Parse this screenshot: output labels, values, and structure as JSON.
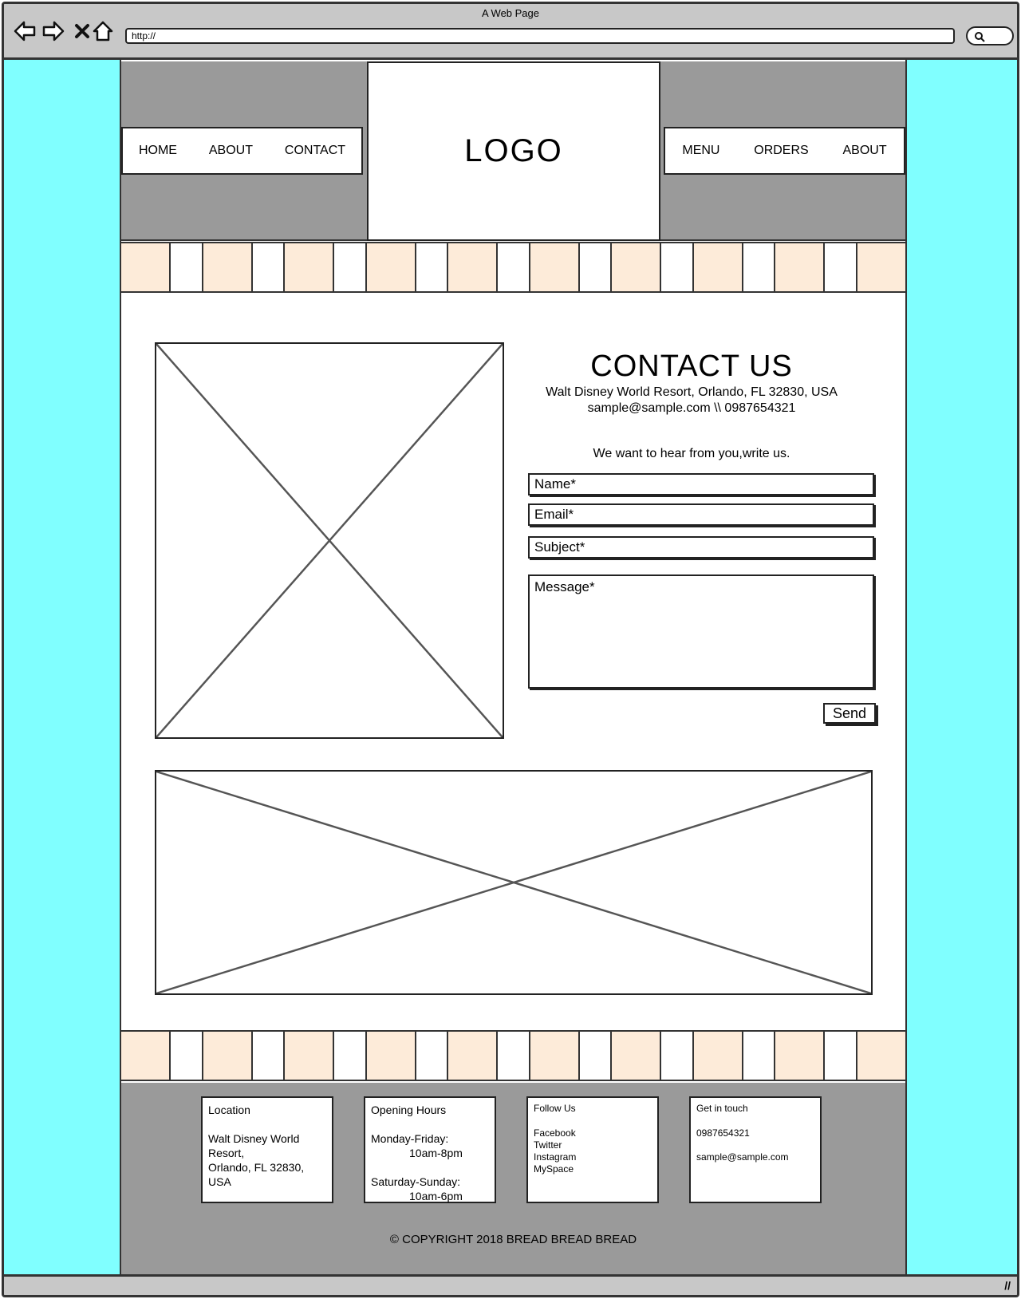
{
  "browser": {
    "title": "A Web Page",
    "url": "http://"
  },
  "header": {
    "logo": "LOGO",
    "nav_left": [
      "HOME",
      "ABOUT",
      "CONTACT"
    ],
    "nav_right": [
      "MENU",
      "ORDERS",
      "ABOUT"
    ]
  },
  "contact": {
    "title": "CONTACT US",
    "address": "Walt Disney World Resort, Orlando, FL 32830, USA",
    "email_phone": "sample@sample.com \\\\ 0987654321",
    "intro": "We want to hear from you,write us.",
    "fields": {
      "name_placeholder": "Name*",
      "email_placeholder": "Email*",
      "subject_placeholder": "Subject*",
      "message_placeholder": "Message*"
    },
    "send_label": "Send"
  },
  "footer": {
    "location": {
      "heading": "Location",
      "line1": "Walt Disney World",
      "line2": "Resort,",
      "line3": "Orlando, FL 32830,",
      "line4": "USA"
    },
    "hours": {
      "heading": "Opening Hours",
      "weekday_label": "Monday-Friday:",
      "weekday_time": "10am-8pm",
      "weekend_label": "Saturday-Sunday:",
      "weekend_time": "10am-6pm"
    },
    "follow": {
      "heading": "Follow Us",
      "links": [
        "Facebook",
        "Twitter",
        "Instagram",
        "MySpace"
      ]
    },
    "touch": {
      "heading": "Get in touch",
      "phone": "0987654321",
      "email": "sample@sample.com"
    },
    "copyright": "© COPYRIGHT 2018 BREAD BREAD BREAD"
  },
  "colors": {
    "side_background": "#80ffff",
    "header_gray": "#9a9a9a",
    "stripe_peach": "#fdebd9"
  }
}
